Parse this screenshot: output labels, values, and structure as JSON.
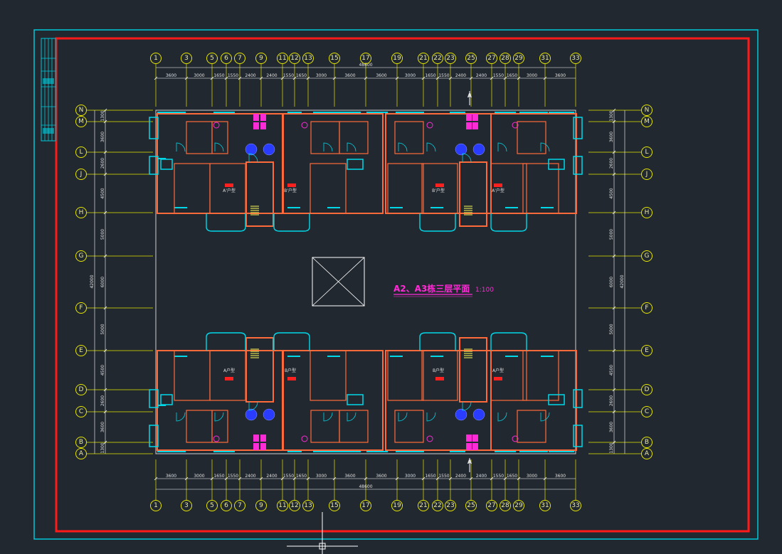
{
  "drawing": {
    "title": "A2、A3栋三层平面",
    "scale": "1:100",
    "section_mark": "A"
  },
  "colors": {
    "background": "#212830",
    "frame_outer": "#00c8d8",
    "frame_inner": "#ff1a1a",
    "axis_line": "#e6e600",
    "axis_bubble": "#e6e600",
    "wall": "#ff6a3a",
    "window": "#00d8e8",
    "title": "#ff2bd6",
    "dimension": "#ffffff",
    "door": "#ffff55",
    "fixture_magenta": "#ff2bd6",
    "fixture_blue": "#2a3cff"
  },
  "horizontal_axes": [
    "1",
    "3",
    "5",
    "6",
    "7",
    "9",
    "11",
    "12",
    "13",
    "15",
    "17",
    "19",
    "21",
    "22",
    "23",
    "25",
    "27",
    "28",
    "29",
    "31",
    "33"
  ],
  "vertical_axes": [
    "N",
    "M",
    "L",
    "J",
    "H",
    "G",
    "F",
    "E",
    "D",
    "C",
    "B",
    "A"
  ],
  "horizontal_dimensions": [
    "3600",
    "3000",
    "1650",
    "1550",
    "2400",
    "2400",
    "1550",
    "1650",
    "3000",
    "3600",
    "3600",
    "3000",
    "1650",
    "1550",
    "2400",
    "2400",
    "1550",
    "1650",
    "3000",
    "3600"
  ],
  "horizontal_total": "48600",
  "vertical_dimensions": [
    "1300",
    "3600",
    "2600",
    "4500",
    "5000",
    "6000",
    "5000",
    "4500",
    "2600",
    "3600",
    "1300"
  ],
  "vertical_total": "42000",
  "units": {
    "top": [
      "A'户型",
      "B'户型",
      "B'户型",
      "A'户型"
    ],
    "bottom": [
      "A户型",
      "B户型",
      "B户型",
      "A户型"
    ]
  }
}
